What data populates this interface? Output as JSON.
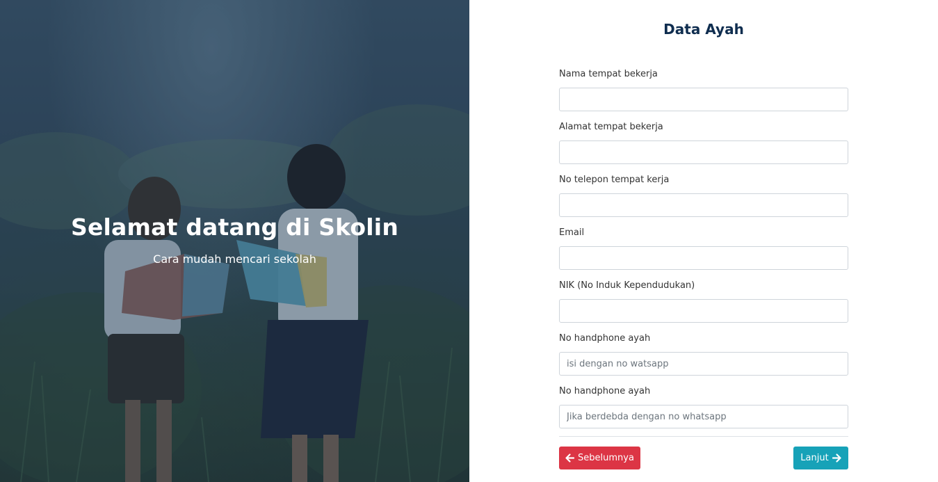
{
  "hero": {
    "title": "Selamat datang di Skolin",
    "subtitle": "Cara mudah mencari sekolah"
  },
  "form": {
    "title": "Data Ayah",
    "fields": [
      {
        "label": "Nama tempat bekerja",
        "value": "",
        "placeholder": ""
      },
      {
        "label": "Alamat tempat bekerja",
        "value": "",
        "placeholder": ""
      },
      {
        "label": "No telepon tempat kerja",
        "value": "",
        "placeholder": ""
      },
      {
        "label": "Email",
        "value": "",
        "placeholder": ""
      },
      {
        "label": "NIK (No Induk Kependudukan)",
        "value": "",
        "placeholder": ""
      },
      {
        "label": "No handphone ayah",
        "value": "",
        "placeholder": "isi dengan no watsapp"
      },
      {
        "label": "No handphone ayah",
        "value": "",
        "placeholder": "Jika berdebda dengan no whatsapp"
      }
    ],
    "buttons": {
      "prev_label": "Sebelumnya",
      "prev_icon": "arrow-left-icon",
      "prev_color": "#dc3545",
      "next_label": "Lanjut",
      "next_icon": "arrow-right-icon",
      "next_color": "#17a2b8"
    }
  },
  "colors": {
    "title_color": "#0f2d4f",
    "overlay": "#1e3750"
  }
}
